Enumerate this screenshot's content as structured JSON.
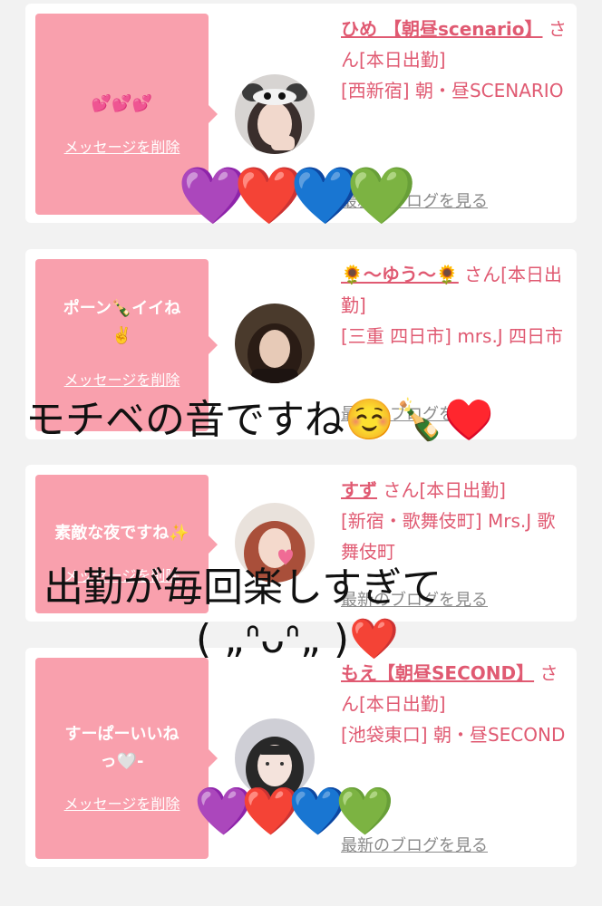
{
  "cards": [
    {
      "message": "💕💕💕",
      "delete_label": "メッセージを削除",
      "name": "ひめ 【朝昼scenario】",
      "suffix": " さん[本日出勤]",
      "location": "[西新宿] 朝・昼SCENARIO",
      "blog_label": "最新のブログを見る"
    },
    {
      "message": "ポーン🍾イイね✌️",
      "delete_label": "メッセージを削除",
      "name": "🌻〜ゆう〜🌻",
      "suffix": " さん[本日出勤]",
      "location": "[三重 四日市] mrs.J 四日市",
      "blog_label": "最新のブログを見る"
    },
    {
      "message": "素敵な夜ですね✨",
      "delete_label": "メッセージを削除",
      "name": "すず",
      "suffix": " さん[本日出勤]",
      "location": "[新宿・歌舞伎町] Mrs.J 歌舞伎町",
      "blog_label": "最新のブログを見る"
    },
    {
      "message": "すーぱーいいねっ🤍-",
      "delete_label": "メッセージを削除",
      "name": "もえ【朝昼SECOND】",
      "suffix": " さん[本日出勤]",
      "location": "[池袋東口] 朝・昼SECOND",
      "blog_label": "最新のブログを見る"
    }
  ],
  "overlays": {
    "text1": "モチベの音ですね☺️🍾♥️",
    "text2_line1": "出勤が毎回楽しすぎて",
    "text2_line2": "( „ᐢᴗᐢ„ )❤️"
  },
  "hearts": [
    "💜",
    "❤️",
    "💙",
    "💚"
  ],
  "colors": {
    "bubble": "#f9a0ad",
    "name": "#e05a72",
    "link_gray": "#8a8a8a"
  }
}
